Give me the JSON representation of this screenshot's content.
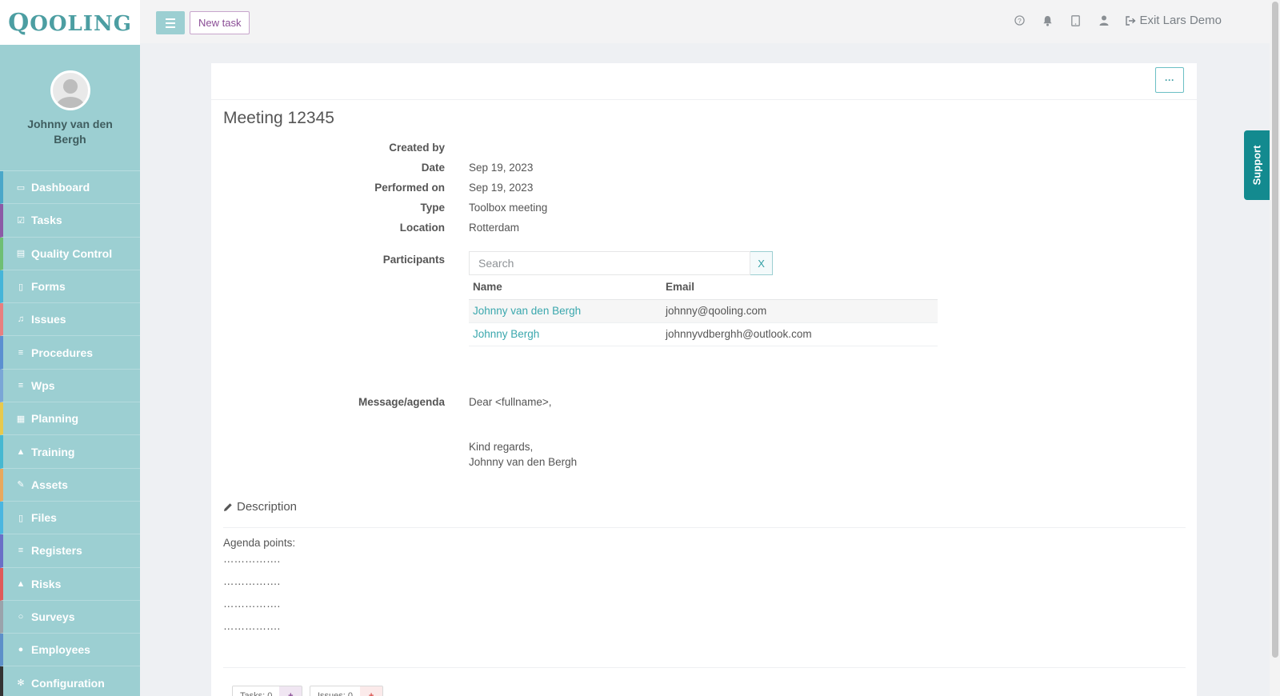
{
  "app": {
    "logo": "Qooling",
    "logo_first": "Q",
    "logo_rest": "OOLING"
  },
  "user": {
    "name": "Johnny van den Bergh"
  },
  "sidebar": {
    "items": [
      {
        "label": "Dashboard",
        "icon": "monitor-icon",
        "color": "#4aa7c9"
      },
      {
        "label": "Tasks",
        "icon": "check-square-icon",
        "color": "#8c5aa6"
      },
      {
        "label": "Quality Control",
        "icon": "book-icon",
        "color": "#6fbf73"
      },
      {
        "label": "Forms",
        "icon": "file-icon",
        "color": "#45b5d9"
      },
      {
        "label": "Issues",
        "icon": "bell-icon",
        "color": "#e87f7f"
      },
      {
        "label": "Procedures",
        "icon": "list-icon",
        "color": "#5b8fd1"
      },
      {
        "label": "Wps",
        "icon": "list-icon",
        "color": "#7aa6d6"
      },
      {
        "label": "Planning",
        "icon": "calendar-icon",
        "color": "#e7c94d"
      },
      {
        "label": "Training",
        "icon": "graduation-cap-icon",
        "color": "#46b8d1"
      },
      {
        "label": "Assets",
        "icon": "wrench-icon",
        "color": "#e8a85d"
      },
      {
        "label": "Files",
        "icon": "file-pdf-icon",
        "color": "#4ab6e0"
      },
      {
        "label": "Registers",
        "icon": "bars-icon",
        "color": "#6a6fc7"
      },
      {
        "label": "Risks",
        "icon": "warning-icon",
        "color": "#e05a5a"
      },
      {
        "label": "Surveys",
        "icon": "comment-icon",
        "color": "#9aa3ab"
      },
      {
        "label": "Employees",
        "icon": "users-icon",
        "color": "#5d8fc9"
      },
      {
        "label": "Configuration",
        "icon": "gear-icon",
        "color": "#333333"
      }
    ]
  },
  "topbar": {
    "new_task": "New task",
    "exit_label": "Exit Lars Demo"
  },
  "page": {
    "title": "Meeting 12345",
    "fields": {
      "created_by_label": "Created by",
      "created_by_value": "",
      "date_label": "Date",
      "date_value": "Sep 19, 2023",
      "performed_on_label": "Performed on",
      "performed_on_value": "Sep 19, 2023",
      "type_label": "Type",
      "type_value": "Toolbox meeting",
      "location_label": "Location",
      "location_value": "Rotterdam",
      "participants_label": "Participants",
      "message_label": "Message/agenda"
    },
    "participants": {
      "search_placeholder": "Search",
      "clear_label": "X",
      "col_name": "Name",
      "col_email": "Email",
      "rows": [
        {
          "name": "Johnny van den Bergh",
          "email": "johnny@qooling.com"
        },
        {
          "name": "Johnny Bergh",
          "email": "johnnyvdberghh@outlook.com"
        }
      ]
    },
    "message": {
      "line1": "Dear <fullname>,",
      "line2": "Kind regards,",
      "line3": "Johnny van den Bergh"
    },
    "description": {
      "heading": "Description",
      "intro": "Agenda points:",
      "points": [
        "…………….",
        "…………….",
        "…………….",
        "……………."
      ]
    },
    "footer": {
      "tasks_label": "Tasks: 0",
      "issues_label": "Issues: 0",
      "plus": "+"
    },
    "more_label": "···"
  },
  "support": {
    "label": "Support"
  },
  "colors": {
    "accent": "#9ccfd2",
    "link": "#3aa7ad",
    "support": "#138a8f",
    "new_task": "#8a4d96"
  }
}
